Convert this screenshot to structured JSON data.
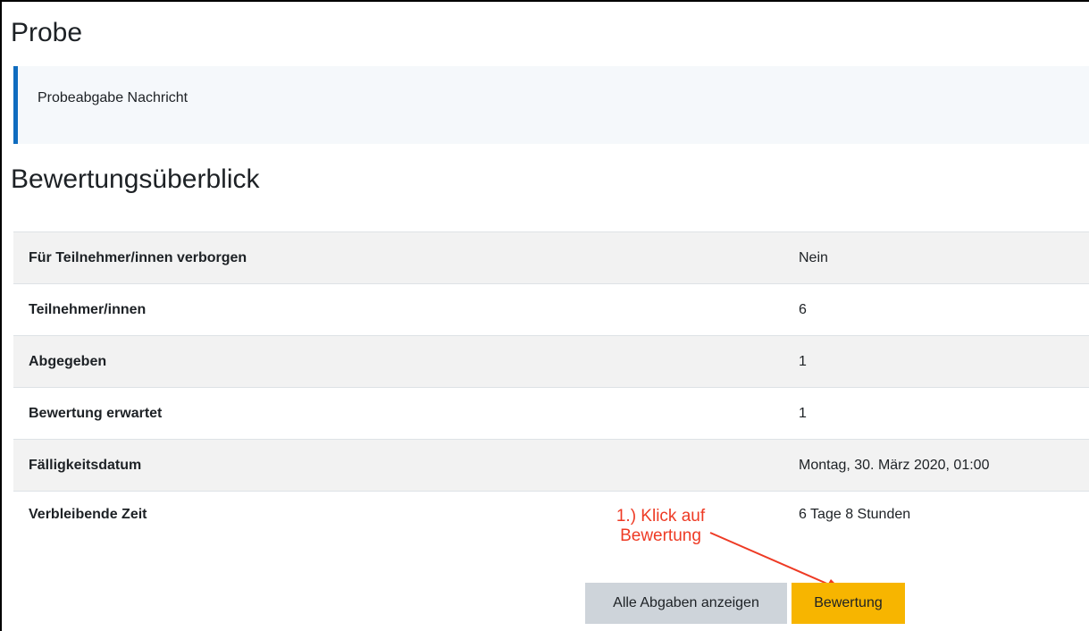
{
  "page": {
    "title": "Probe",
    "intro": "Probeabgabe Nachricht",
    "section_title": "Bewertungsüberblick"
  },
  "summary": {
    "rows": [
      {
        "label": "Für Teilnehmer/innen verborgen",
        "value": "Nein"
      },
      {
        "label": "Teilnehmer/innen",
        "value": "6"
      },
      {
        "label": "Abgegeben",
        "value": "1"
      },
      {
        "label": "Bewertung erwartet",
        "value": "1"
      },
      {
        "label": "Fälligkeitsdatum",
        "value": "Montag, 30. März 2020, 01:00"
      },
      {
        "label": "Verbleibende Zeit",
        "value": "6 Tage 8 Stunden"
      }
    ]
  },
  "annotation": {
    "line1": "1.) Klick auf",
    "line2": "Bewertung",
    "color": "#ee3a24"
  },
  "buttons": {
    "view_all": "Alle Abgaben anzeigen",
    "grade": "Bewertung"
  },
  "colors": {
    "accent": "#0f6cbf",
    "primary_button": "#f7b500",
    "secondary_button": "#ced4da"
  }
}
